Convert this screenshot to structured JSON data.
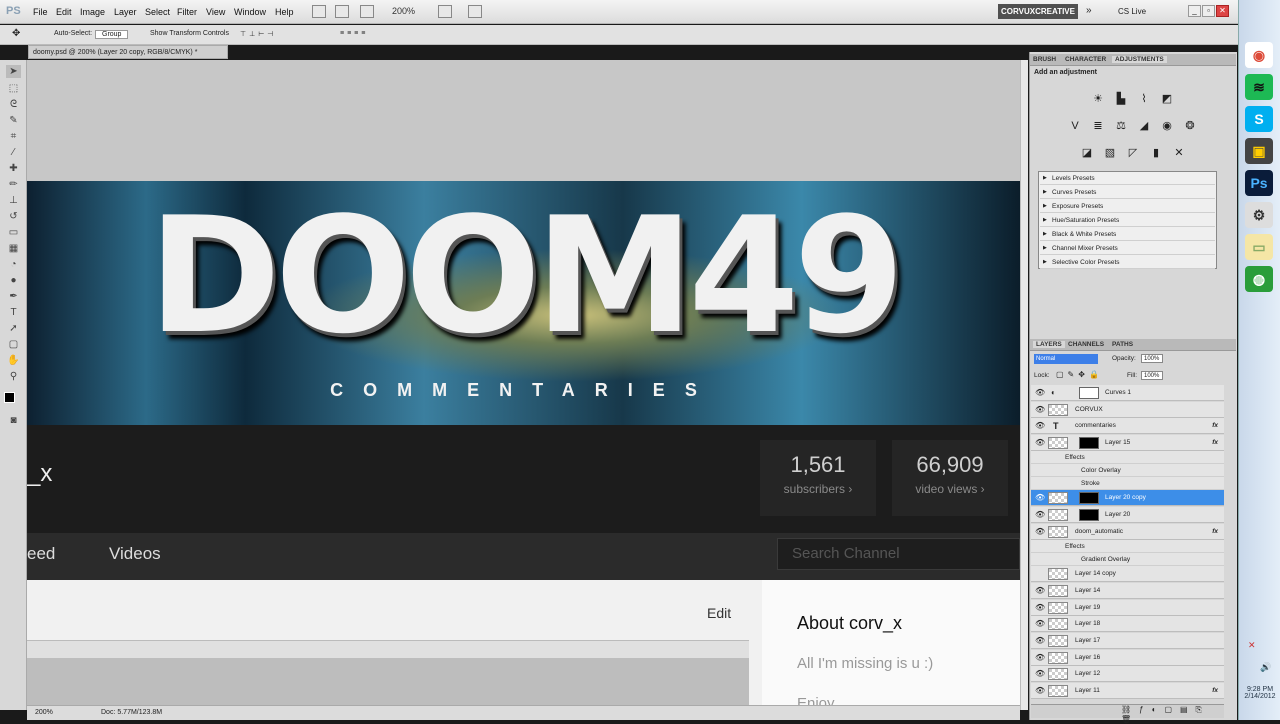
{
  "app": {
    "logo": "PS",
    "document_tab": "doomy.psd @ 200% (Layer 20 copy, RGB/8/CMYK) *"
  },
  "menu": [
    "File",
    "Edit",
    "Image",
    "Layer",
    "Select",
    "Filter",
    "View",
    "Window",
    "Help"
  ],
  "toolbar": {
    "zoom": "200%",
    "workspace": "CORVUXCREATIVE",
    "cs_live": "CS Live"
  },
  "options": {
    "auto_select": "Auto-Select:",
    "group": "Group",
    "show_transform": "Show Transform Controls"
  },
  "canvas": {
    "banner_title": "DOOM49",
    "banner_subtitle": "COMMENTARIES",
    "channel_name": "_x",
    "subscribers_count": "1,561",
    "subscribers_label": "subscribers ›",
    "views_count": "66,909",
    "views_label": "video views ›",
    "nav_feed": "eed",
    "nav_videos": "Videos",
    "search_placeholder": "Search Channel",
    "edit": "Edit",
    "about_title": "About corv_x",
    "about_text": "All I'm missing is u :)",
    "about_more": "Enjoy"
  },
  "status": {
    "zoom": "200%",
    "doc": "Doc: 5.77M/123.8M"
  },
  "panels": {
    "top_tabs": [
      "BRUSH",
      "CHARACTER",
      "ADJUSTMENTS"
    ],
    "add_adjustment": "Add an adjustment",
    "presets": [
      "Levels Presets",
      "Curves Presets",
      "Exposure Presets",
      "Hue/Saturation Presets",
      "Black & White Presets",
      "Channel Mixer Presets",
      "Selective Color Presets"
    ],
    "layer_tabs": [
      "LAYERS",
      "CHANNELS",
      "PATHS"
    ],
    "blend_mode": "Normal",
    "opacity_label": "Opacity:",
    "opacity": "100%",
    "lock_label": "Lock:",
    "fill_label": "Fill:",
    "fill": "100%",
    "layers": [
      {
        "name": "Curves 1"
      },
      {
        "name": "CORVUX"
      },
      {
        "name": "commentaries"
      },
      {
        "name": "Layer 15"
      },
      {
        "name": "Effects"
      },
      {
        "name": "Color Overlay"
      },
      {
        "name": "Stroke"
      },
      {
        "name": "Layer 20 copy"
      },
      {
        "name": "Layer 20"
      },
      {
        "name": "doom_automatic"
      },
      {
        "name": "Effects"
      },
      {
        "name": "Gradient Overlay"
      },
      {
        "name": "Layer 14 copy"
      },
      {
        "name": "Layer 14"
      },
      {
        "name": "Layer 19"
      },
      {
        "name": "Layer 18"
      },
      {
        "name": "Layer 17"
      },
      {
        "name": "Layer 16"
      },
      {
        "name": "Layer 12"
      },
      {
        "name": "Layer 11"
      }
    ]
  },
  "taskbar": {
    "time": "9:28 PM",
    "date": "2/14/2012"
  }
}
